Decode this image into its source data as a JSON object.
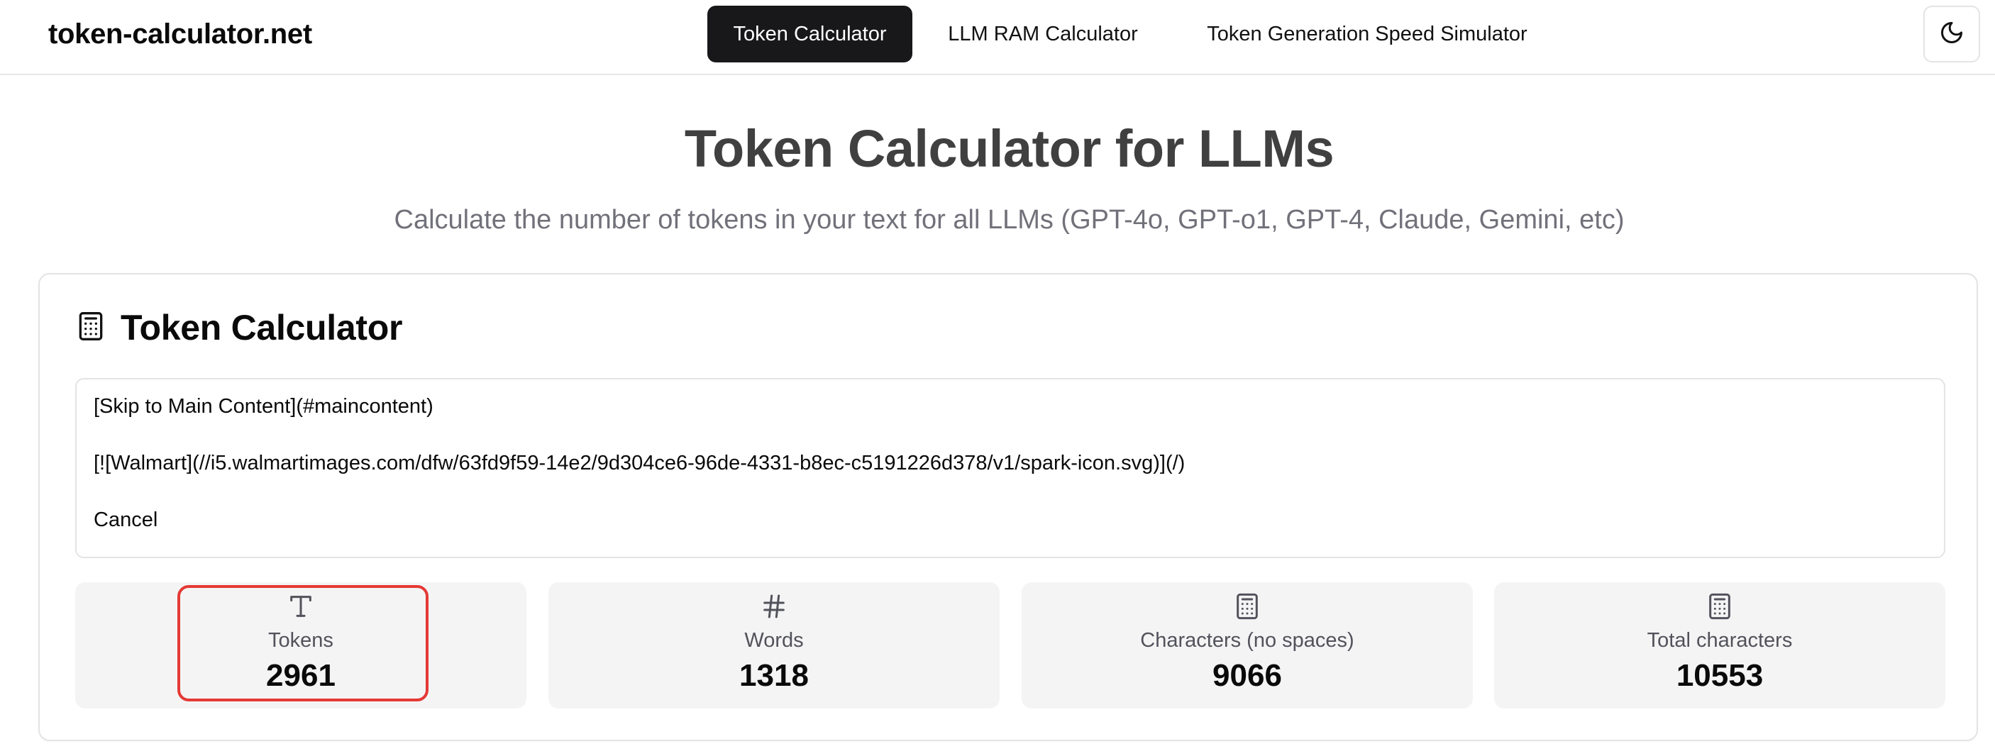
{
  "header": {
    "brand": "token-calculator.net",
    "nav": [
      {
        "label": "Token Calculator",
        "active": true
      },
      {
        "label": "LLM RAM Calculator",
        "active": false
      },
      {
        "label": "Token Generation Speed Simulator",
        "active": false
      }
    ],
    "theme_toggle_icon": "moon-icon"
  },
  "hero": {
    "title": "Token Calculator for LLMs",
    "subtitle": "Calculate the number of tokens in your text for all LLMs (GPT-4o, GPT-o1, GPT-4, Claude, Gemini, etc)"
  },
  "calculator": {
    "title": "Token Calculator",
    "title_icon": "calculator-icon",
    "input_lines": [
      "[Skip to Main Content](#maincontent)",
      "[![Walmart](//i5.walmartimages.com/dfw/63fd9f59-14e2/9d304ce6-96de-4331-b8ec-c5191226d378/v1/spark-icon.svg)](/)",
      "Cancel"
    ],
    "stats": [
      {
        "icon": "type-icon",
        "label": "Tokens",
        "value": "2961",
        "highlighted": true
      },
      {
        "icon": "hash-icon",
        "label": "Words",
        "value": "1318"
      },
      {
        "icon": "calculator-icon",
        "label": "Characters (no spaces)",
        "value": "9066"
      },
      {
        "icon": "calculator-icon",
        "label": "Total characters",
        "value": "10553"
      }
    ]
  },
  "colors": {
    "active_tab_bg": "#18181b",
    "stat_bg": "#f4f4f5",
    "highlight_border": "#e53935"
  }
}
